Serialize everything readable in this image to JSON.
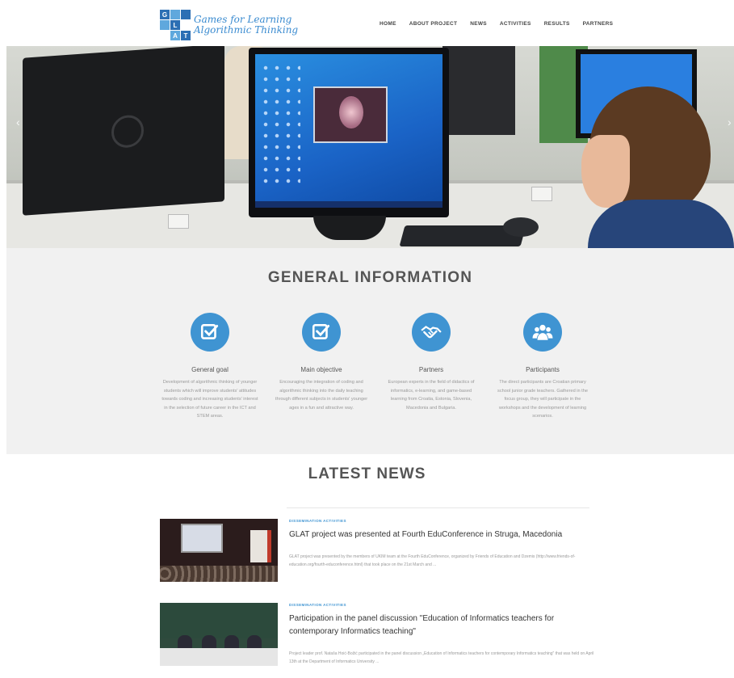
{
  "header": {
    "logo": {
      "letters": [
        "G",
        "",
        "",
        "",
        "L",
        "",
        "",
        "A",
        "T"
      ],
      "line1": "Games for Learning",
      "line2": "Algorithmic Thinking"
    },
    "nav": [
      "HOME",
      "ABOUT PROJECT",
      "NEWS",
      "ACTIVITIES",
      "RESULTS",
      "PARTNERS"
    ]
  },
  "hero": {
    "prev_arrow": "‹",
    "next_arrow": "›"
  },
  "general": {
    "title": "GENERAL INFORMATION",
    "features": [
      {
        "icon": "checkbox-icon",
        "title": "General goal",
        "desc": "Development of algorithmic thinking of younger students which will improve students' attitudes towards coding and increasing students' interest in the selection of future career in the ICT and STEM areas."
      },
      {
        "icon": "checkbox-icon",
        "title": "Main objective",
        "desc": "Encouraging the integration of coding and algorithmic thinking into the daily teaching through different subjects in students' younger ages in a fun and attractive way."
      },
      {
        "icon": "handshake-icon",
        "title": "Partners",
        "desc": "European experts in the field of didactics of informatics, e-learning, and game-based learning from Croatia, Estonia, Slovenia, Macedonia and Bulgaria."
      },
      {
        "icon": "group-icon",
        "title": "Participants",
        "desc": "The direct participants are Croatian primary school junior grade teachers. Gathered in the focus group, they will participate in the workshops and the development of learning scenarios."
      }
    ]
  },
  "news": {
    "title": "LATEST NEWS",
    "items": [
      {
        "category": "DISSEMINATION ACTIVITIES",
        "headline": "GLAT project was presented at Fourth EduConference in Struga, Macedonia",
        "excerpt": "GLAT project was presented by the members of UKIM team at the Fourth EduConference, organized by Friends of Education and Dzemis (http://www.friends-of-education.org/fourth-educonference.html) that took place on the 21st March and ..."
      },
      {
        "category": "DISSEMINATION ACTIVITIES",
        "headline": "Participation in the panel discussion \"Education of Informatics teachers for contemporary Informatics teaching\"",
        "excerpt": "Project leader prof. Nataša Hoić-Božić participated in the panel discussion „Education of Informatics teachers for contemporary Informatics teaching\" that was held on April 13th at the Department of Informatics University ..."
      }
    ]
  },
  "colors": {
    "accent": "#3f94d2",
    "logo_dark": "#2c6fb4",
    "logo_light": "#5fa8dd",
    "section_bg": "#f1f1f1"
  }
}
